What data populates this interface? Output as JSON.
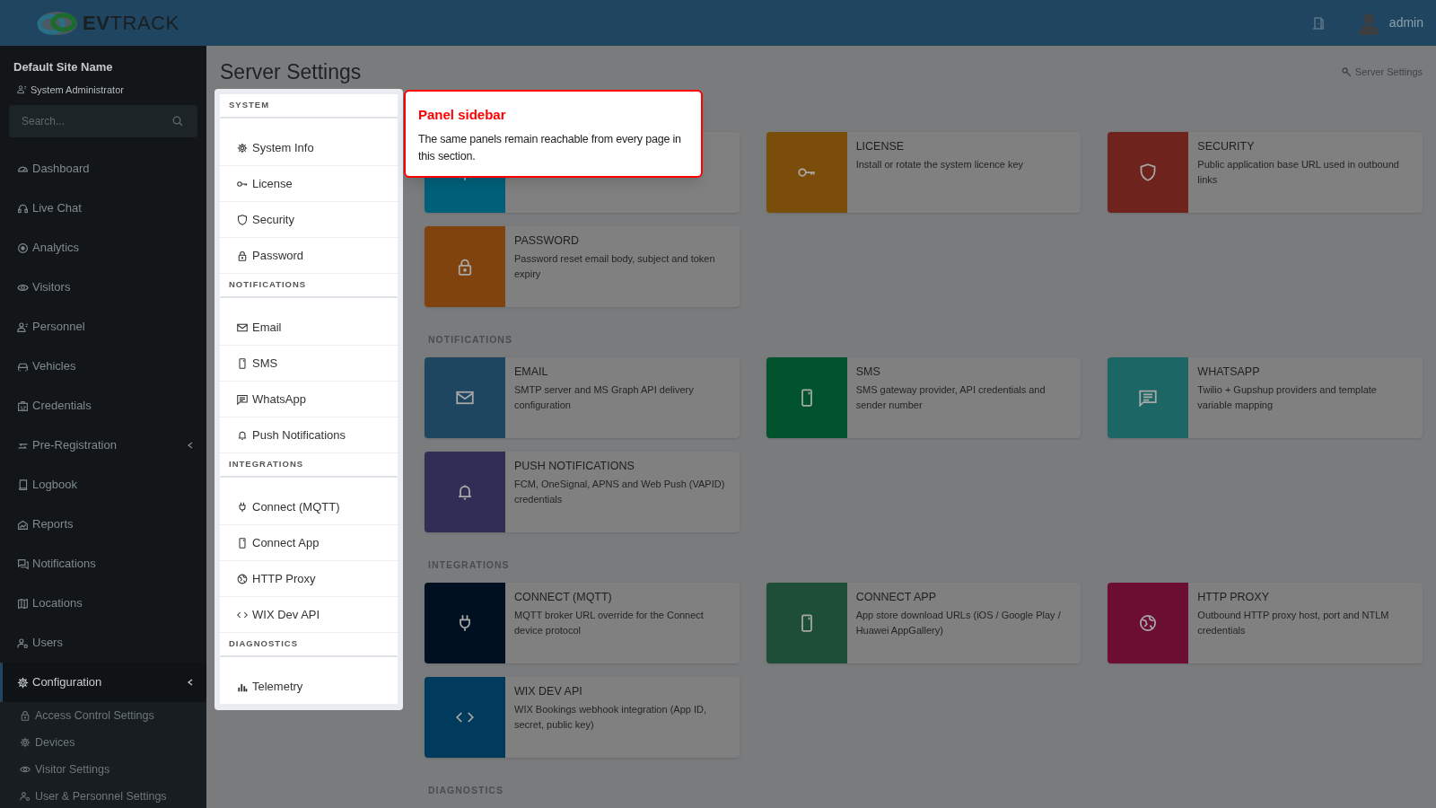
{
  "header": {
    "logo": "**EV**TRACK",
    "user": "admin"
  },
  "sidebar": {
    "site_name": "Default Site Name",
    "role": "System Administrator",
    "search": {
      "placeholder": "Search..."
    },
    "items": [
      {
        "label": "Dashboard",
        "kind": "gauge",
        "selected": false
      },
      {
        "label": "Live Chat",
        "kind": "headset",
        "selected": false
      },
      {
        "label": "Analytics",
        "kind": "target",
        "selected": false
      },
      {
        "label": "Visitors",
        "kind": "eye",
        "selected": false
      },
      {
        "label": "Personnel",
        "kind": "person",
        "selected": false
      },
      {
        "label": "Vehicles",
        "kind": "car",
        "selected": false
      },
      {
        "label": "Credentials",
        "kind": "idcard",
        "selected": false
      },
      {
        "label": "Pre-Registration",
        "kind": "swap",
        "selected": false,
        "submenu": true
      },
      {
        "label": "Logbook",
        "kind": "book",
        "selected": false
      },
      {
        "label": "Reports",
        "kind": "house",
        "selected": false
      },
      {
        "label": "Notifications",
        "kind": "chat",
        "selected": false
      },
      {
        "label": "Locations",
        "kind": "map",
        "selected": false
      },
      {
        "label": "Users",
        "kind": "users",
        "selected": false
      },
      {
        "label": "Configuration",
        "kind": "gear",
        "selected": true,
        "submenu": true,
        "children": [
          {
            "label": "Access Control Settings",
            "kind": "lock",
            "selected": false
          },
          {
            "label": "Devices",
            "kind": "gear",
            "selected": false
          },
          {
            "label": "Visitor Settings",
            "kind": "eye",
            "selected": false
          },
          {
            "label": "User & Personnel Settings",
            "kind": "users",
            "selected": false
          }
        ]
      }
    ]
  },
  "page": {
    "title": "Server Settings",
    "breadcrumb": "Server Settings"
  },
  "panel_sidebar": [
    {
      "title": "SYSTEM",
      "items": [
        {
          "label": "System Info",
          "kind": "gear"
        },
        {
          "label": "License",
          "kind": "key"
        },
        {
          "label": "Security",
          "kind": "shield"
        },
        {
          "label": "Password",
          "kind": "lock"
        }
      ]
    },
    {
      "title": "NOTIFICATIONS",
      "items": [
        {
          "label": "Email",
          "kind": "mail"
        },
        {
          "label": "SMS",
          "kind": "phone"
        },
        {
          "label": "WhatsApp",
          "kind": "message"
        },
        {
          "label": "Push Notifications",
          "kind": "bell"
        }
      ]
    },
    {
      "title": "INTEGRATIONS",
      "items": [
        {
          "label": "Connect (MQTT)",
          "kind": "plug"
        },
        {
          "label": "Connect App",
          "kind": "phone"
        },
        {
          "label": "HTTP Proxy",
          "kind": "globe"
        },
        {
          "label": "WIX Dev API",
          "kind": "code"
        }
      ]
    },
    {
      "title": "DIAGNOSTICS",
      "items": [
        {
          "label": "Telemetry",
          "kind": "bars"
        }
      ]
    }
  ],
  "sections": [
    {
      "cards": [
        {
          "kind": "gear",
          "color": "#00607a"
        },
        {
          "title": "LICENSE",
          "description": "Install or rotate the system licence key",
          "kind": "key",
          "color": "#7a4e0a"
        },
        {
          "title": "SECURITY",
          "description": "Public application base URL used in outbound links",
          "kind": "shield",
          "color": "#6e231c"
        },
        {
          "title": "PASSWORD",
          "description": "Password reset email body, subject and token expiry",
          "kind": "lock",
          "color": "#80430e"
        }
      ]
    },
    {
      "title": "NOTIFICATIONS",
      "cards": [
        {
          "title": "EMAIL",
          "description": "SMTP server and MS Graph API delivery configuration",
          "kind": "mail",
          "color": "#1e4660"
        },
        {
          "title": "SMS",
          "description": "SMS gateway provider, API credentials and sender number",
          "kind": "phone",
          "color": "#00532d"
        },
        {
          "title": "WHATSAPP",
          "description": "Twilio + Gupshup providers and template variable mapping",
          "kind": "message",
          "color": "#1c6666"
        },
        {
          "title": "PUSH NOTIFICATIONS",
          "description": "FCM, OneSignal, APNS and Web Push (VAPID) credentials",
          "kind": "bell",
          "color": "#302e54"
        }
      ]
    },
    {
      "title": "INTEGRATIONS",
      "cards": [
        {
          "title": "CONNECT (MQTT)",
          "description": "MQTT broker URL override for the Connect device protocol",
          "kind": "plug",
          "color": "#001020"
        },
        {
          "title": "CONNECT APP",
          "description": "App store download URLs (iOS / Google Play / Huawei AppGallery)",
          "kind": "phone",
          "color": "#1e4d38"
        },
        {
          "title": "HTTP PROXY",
          "description": "Outbound HTTP proxy host, port and NTLM credentials",
          "kind": "globe",
          "color": "#6c0e30"
        },
        {
          "title": "WIX DEV API",
          "description": "WIX Bookings webhook integration (App ID, secret, public key)",
          "kind": "code",
          "color": "#003a5c"
        }
      ]
    },
    {
      "title": "DIAGNOSTICS"
    }
  ],
  "tooltip": {
    "title": "Panel sidebar",
    "text": "The same panels remain reachable from every page in this section."
  }
}
